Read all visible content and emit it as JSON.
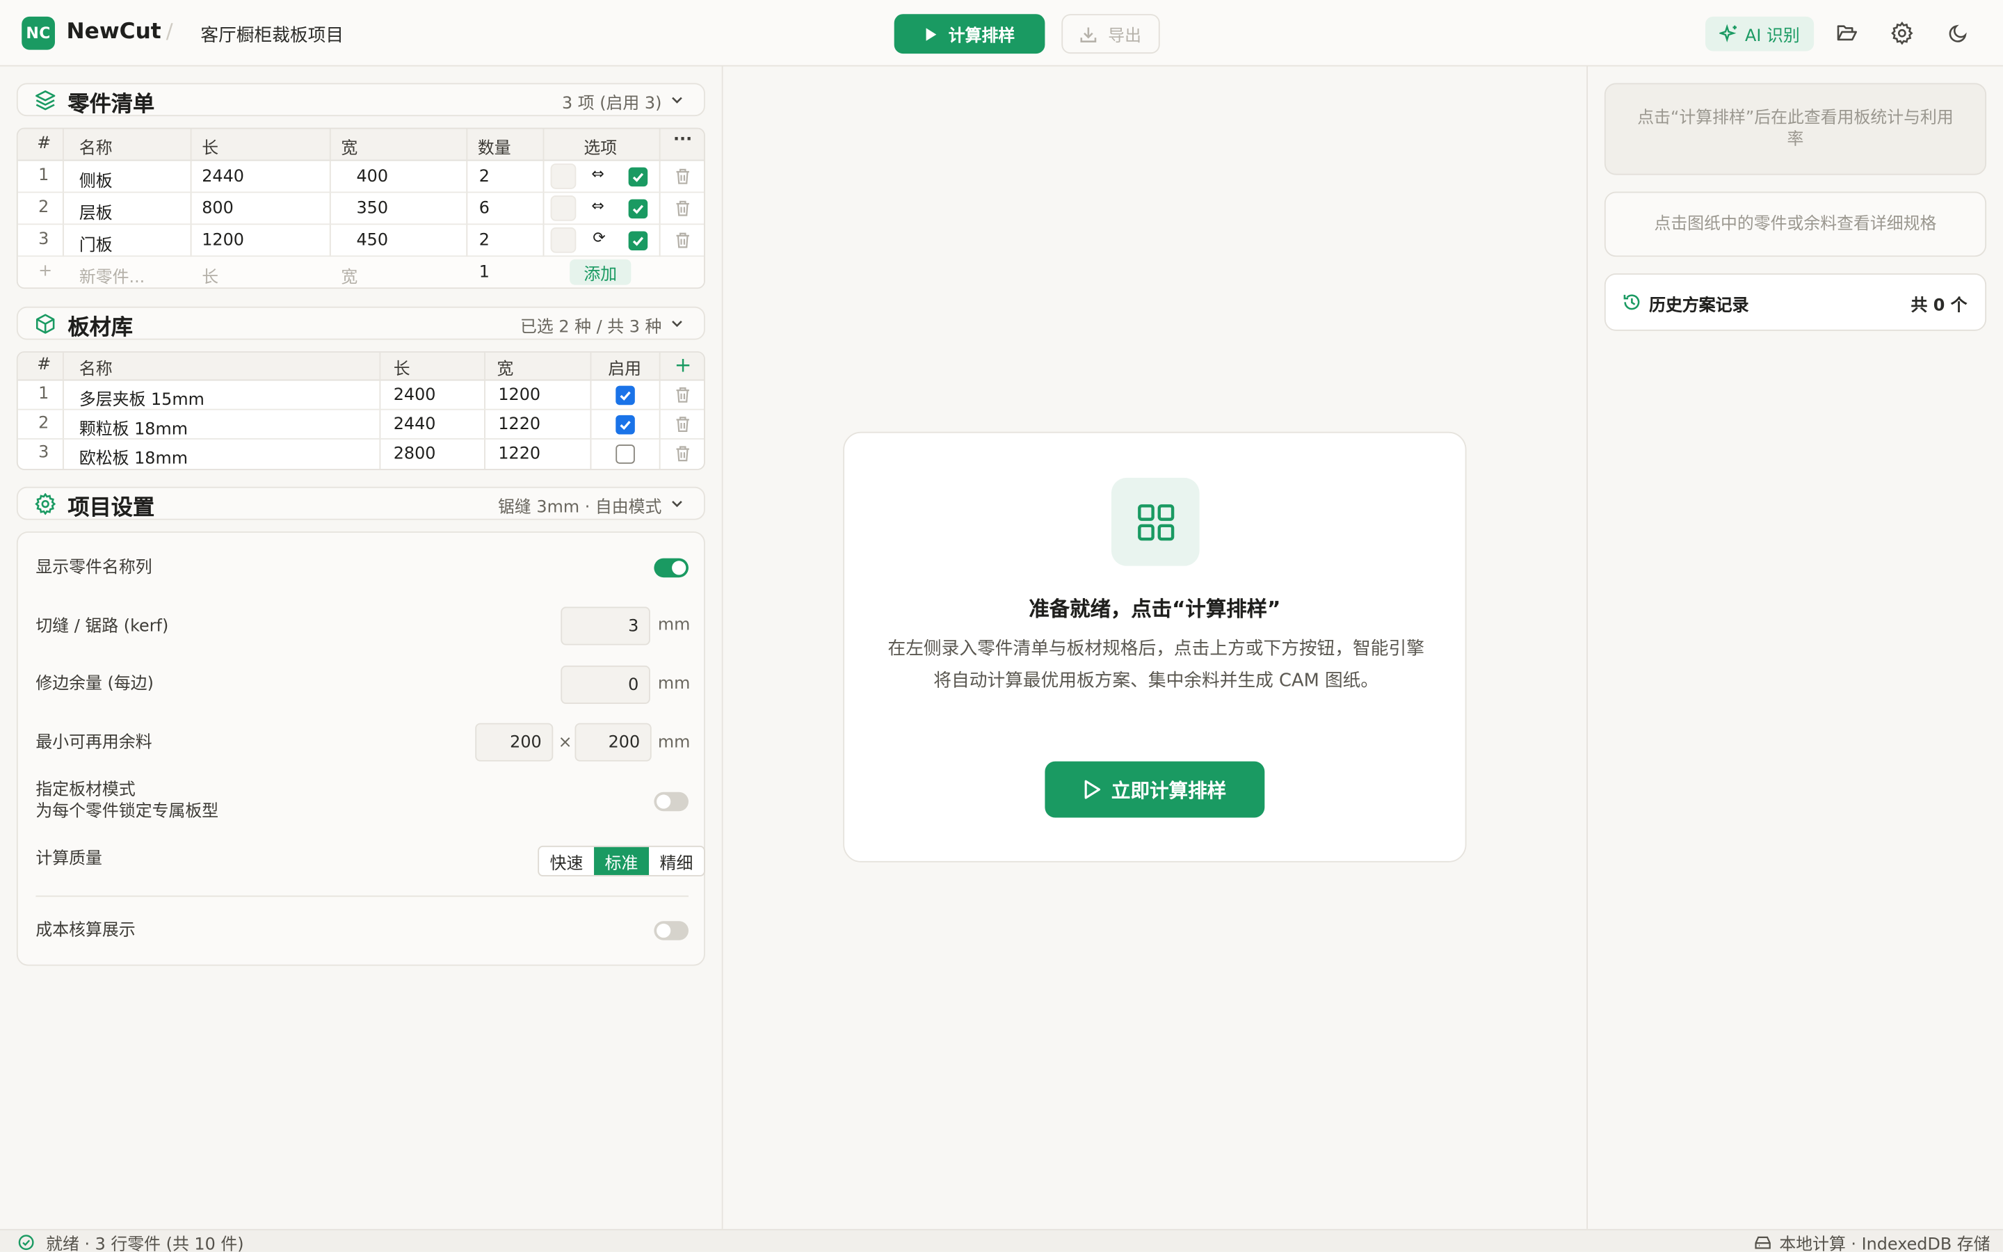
{
  "header": {
    "logo_text": "NC",
    "app_name": "NewCut",
    "separator": "/",
    "project_name": "客厅橱柜裁板项目",
    "compute_label": "计算排样",
    "export_label": "导出",
    "ai_label": "AI 识别",
    "accent_color": "#1a9a62"
  },
  "parts": {
    "title": "零件清单",
    "summary": "3 项 (启用 3)",
    "columns": [
      "#",
      "名称",
      "长",
      "宽",
      "数量",
      "选项"
    ],
    "more_glyph": "···",
    "rows": [
      {
        "idx": "1",
        "name": "侧板",
        "length": "2440",
        "width": "400",
        "qty": "2",
        "grain_icon": "⇔",
        "enabled": true
      },
      {
        "idx": "2",
        "name": "层板",
        "length": "800",
        "width": "350",
        "qty": "6",
        "grain_icon": "⇔",
        "enabled": true
      },
      {
        "idx": "3",
        "name": "门板",
        "length": "1200",
        "width": "450",
        "qty": "2",
        "grain_icon": "⟳",
        "enabled": true
      }
    ],
    "new_row": {
      "plus": "+",
      "name_placeholder": "新零件...",
      "length_placeholder": "长",
      "width_placeholder": "宽",
      "qty": "1",
      "add_label": "添加"
    }
  },
  "boards": {
    "title": "板材库",
    "summary": "已选 2 种 / 共 3 种",
    "columns": [
      "#",
      "名称",
      "长",
      "宽",
      "启用"
    ],
    "add_glyph": "+",
    "rows": [
      {
        "idx": "1",
        "name": "多层夹板 15mm",
        "length": "2400",
        "width": "1200",
        "enabled": true
      },
      {
        "idx": "2",
        "name": "颗粒板 18mm",
        "length": "2440",
        "width": "1220",
        "enabled": true
      },
      {
        "idx": "3",
        "name": "欧松板 18mm",
        "length": "2800",
        "width": "1220",
        "enabled": false
      }
    ]
  },
  "settings": {
    "title": "项目设置",
    "summary": "锯缝 3mm · 自由模式",
    "show_name_label": "显示零件名称列",
    "show_name_on": true,
    "kerf_label": "切缝 / 锯路 (kerf)",
    "kerf_value": "3",
    "trim_label": "修边余量 (每边)",
    "trim_value": "0",
    "min_offcut_label": "最小可再用余料",
    "min_offcut_w": "200",
    "min_offcut_h": "200",
    "times": "×",
    "unit": "mm",
    "assign_mode_label": "指定板材模式",
    "assign_mode_desc": "为每个零件锁定专属板型",
    "assign_mode_on": false,
    "quality_label": "计算质量",
    "quality_options": [
      "快速",
      "标准",
      "精细"
    ],
    "quality_selected": "标准",
    "cost_label": "成本核算展示",
    "cost_on": false
  },
  "empty_state": {
    "title": "准备就绪，点击“计算排样”",
    "description": "在左侧录入零件清单与板材规格后，点击上方或下方按钮，智能引擎将自动计算最优用板方案、集中余料并生成 CAM 图纸。",
    "button_label": "立即计算排样"
  },
  "right": {
    "stats_hint": "点击“计算排样”后在此查看用板统计与利用率",
    "detail_hint": "点击图纸中的零件或余料查看详细规格",
    "history_title": "历史方案记录",
    "history_count": "共 0 个"
  },
  "status": {
    "left": "就绪 · 3 行零件 (共 10 件)",
    "right": "本地计算 · IndexedDB 存储"
  }
}
